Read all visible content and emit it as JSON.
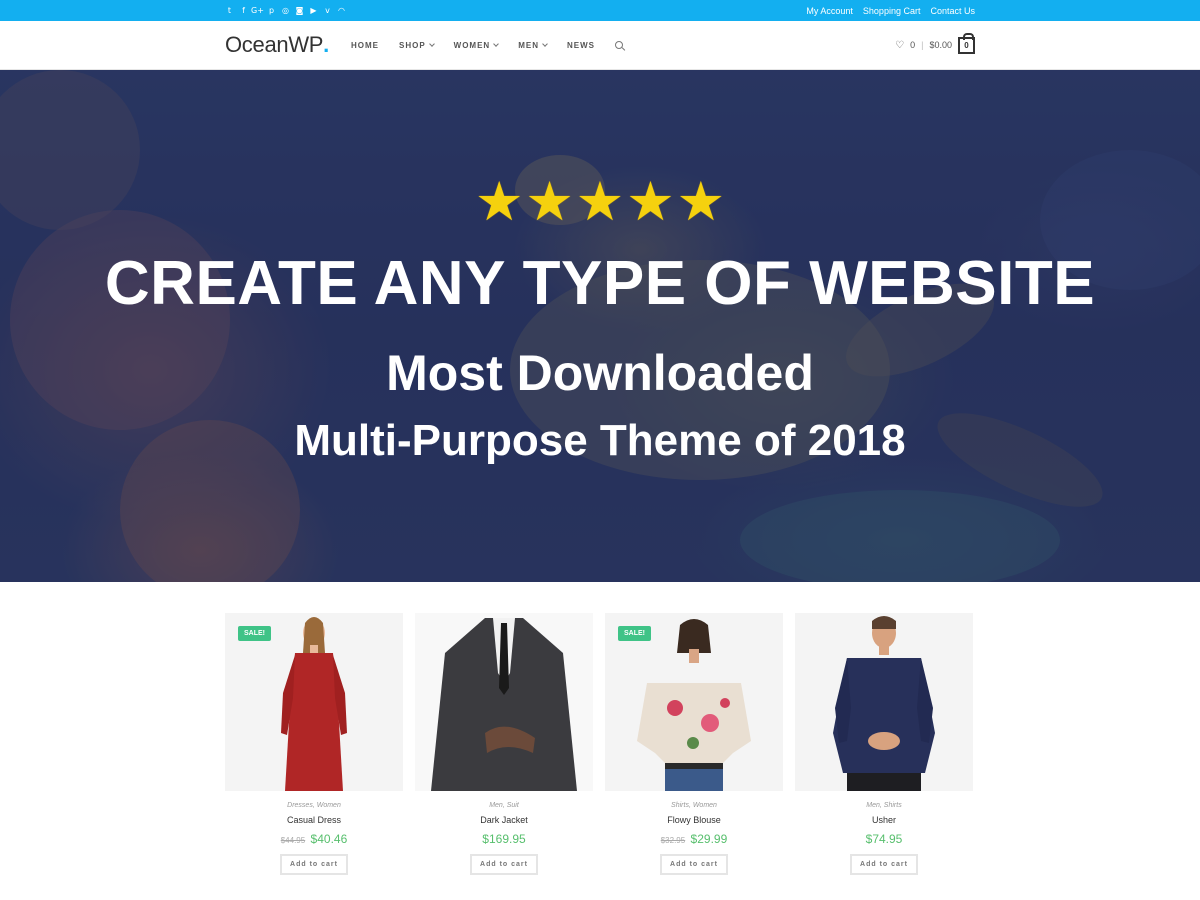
{
  "topbar": {
    "social_icons": [
      "twitter-icon",
      "facebook-icon",
      "google-plus-icon",
      "pinterest-icon",
      "dribbble-icon",
      "instagram-icon",
      "youtube-icon",
      "vimeo-icon",
      "rss-icon"
    ],
    "links": [
      "My Account",
      "Shopping Cart",
      "Contact Us"
    ],
    "color": "#13aff0"
  },
  "header": {
    "logo_text": "OceanWP",
    "logo_dot": ".",
    "nav": [
      "HOME",
      "SHOP",
      "WOMEN",
      "MEN",
      "NEWS"
    ],
    "wishlist_count": "0",
    "cart_total": "$0.00",
    "cart_count": "0"
  },
  "hero": {
    "stars": 5,
    "title": "CREATE ANY TYPE OF WEBSITE",
    "subtitle": "Most Downloaded",
    "subtitle2": "Multi-Purpose Theme of 2018"
  },
  "products": [
    {
      "sale": "SALE!",
      "categories": "Dresses, Women",
      "name": "Casual Dress",
      "old_price": "$44.95",
      "price": "$40.46",
      "button": "Add to cart"
    },
    {
      "sale": "",
      "categories": "Men, Suit",
      "name": "Dark Jacket",
      "old_price": "",
      "price": "$169.95",
      "button": "Add to cart"
    },
    {
      "sale": "SALE!",
      "categories": "Shirts, Women",
      "name": "Flowy Blouse",
      "old_price": "$32.95",
      "price": "$29.99",
      "button": "Add to cart"
    },
    {
      "sale": "",
      "categories": "Men, Shirts",
      "name": "Usher",
      "old_price": "",
      "price": "$74.95",
      "button": "Add to cart"
    }
  ],
  "colors": {
    "accent": "#13aff0",
    "sale_badge": "#3fc387",
    "price": "#57bf6d",
    "star": "#f5d10e"
  }
}
